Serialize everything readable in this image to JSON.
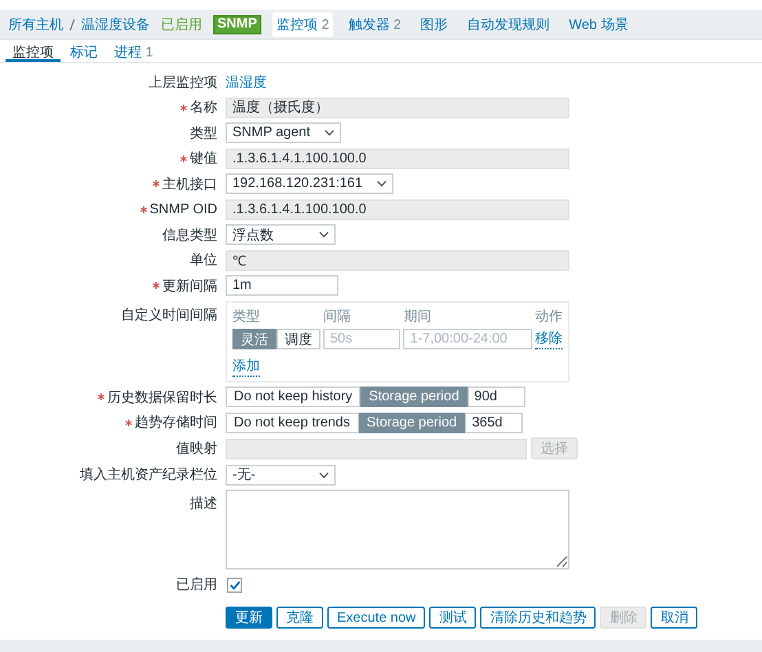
{
  "breadcrumb": [
    "所有主机",
    "温湿度设备"
  ],
  "host_status": {
    "label": "已启用",
    "badges": [
      "SNMP"
    ]
  },
  "nav_links": [
    {
      "label": "监控项",
      "count": "2",
      "selected": true
    },
    {
      "label": "触发器",
      "count": "2",
      "selected": false
    },
    {
      "label": "图形",
      "selected": false
    },
    {
      "label": "自动发现规则",
      "selected": false
    },
    {
      "label": "Web 场景",
      "selected": false
    }
  ],
  "tabs": [
    {
      "label": "监控项",
      "selected": true
    },
    {
      "label": "标记",
      "selected": false
    },
    {
      "label": "进程",
      "count": "1",
      "selected": false
    }
  ],
  "fields": [
    {
      "kind": "link",
      "label": "上层监控项",
      "required": false,
      "value": "温湿度"
    },
    {
      "kind": "readonly",
      "label": "名称",
      "required": true,
      "value": "温度（摄氏度）"
    },
    {
      "kind": "select",
      "label": "类型",
      "required": false,
      "value": "SNMP agent"
    },
    {
      "kind": "readonly",
      "label": "键值",
      "required": true,
      "value": ".1.3.6.1.4.1.100.100.0"
    },
    {
      "kind": "select",
      "label": "主机接口",
      "required": true,
      "value": "192.168.120.231:161"
    },
    {
      "kind": "readonly",
      "label": "SNMP OID",
      "required": true,
      "value": ".1.3.6.1.4.1.100.100.0"
    },
    {
      "kind": "select",
      "label": "信息类型",
      "required": false,
      "value": "浮点数"
    },
    {
      "kind": "readonly",
      "label": "单位",
      "required": false,
      "value": "℃"
    },
    {
      "kind": "text",
      "label": "更新间隔",
      "required": true,
      "value": "1m"
    },
    {
      "kind": "intervals",
      "label": "自定义时间间隔",
      "required": false,
      "columns": [
        "类型",
        "间隔",
        "期间",
        "动作"
      ],
      "rows": [
        {
          "types": [
            {
              "label": "灵活",
              "selected": true
            },
            {
              "label": "调度",
              "selected": false
            }
          ],
          "interval_placeholder": "50s",
          "period_placeholder": "1-7,00:00-24:00",
          "action": "移除"
        }
      ],
      "add": "添加"
    },
    {
      "kind": "storage",
      "label": "历史数据保留时长",
      "required": true,
      "options": [
        {
          "label": "Do not keep history",
          "selected": false
        },
        {
          "label": "Storage period",
          "selected": true
        }
      ],
      "value": "90d"
    },
    {
      "kind": "storage",
      "label": "趋势存储时间",
      "required": true,
      "options": [
        {
          "label": "Do not keep trends",
          "selected": false
        },
        {
          "label": "Storage period",
          "selected": true
        }
      ],
      "value": "365d"
    },
    {
      "kind": "picker",
      "label": "值映射",
      "required": false,
      "button": "选择",
      "disabled": true
    },
    {
      "kind": "select",
      "label": "填入主机资产纪录栏位",
      "required": false,
      "value": "-无-"
    },
    {
      "kind": "textarea",
      "label": "描述",
      "required": false
    },
    {
      "kind": "checkbox",
      "label": "已启用",
      "required": false,
      "checked": true
    }
  ],
  "buttons": [
    {
      "label": "更新",
      "kind": "primary",
      "disabled": false
    },
    {
      "label": "克隆",
      "kind": "secondary",
      "disabled": false
    },
    {
      "label": "Execute now",
      "kind": "secondary",
      "disabled": false
    },
    {
      "label": "测试",
      "kind": "secondary",
      "disabled": false
    },
    {
      "label": "清除历史和趋势",
      "kind": "secondary",
      "disabled": false
    },
    {
      "label": "删除",
      "kind": "secondary",
      "disabled": true
    },
    {
      "label": "取消",
      "kind": "secondary",
      "disabled": false
    }
  ]
}
